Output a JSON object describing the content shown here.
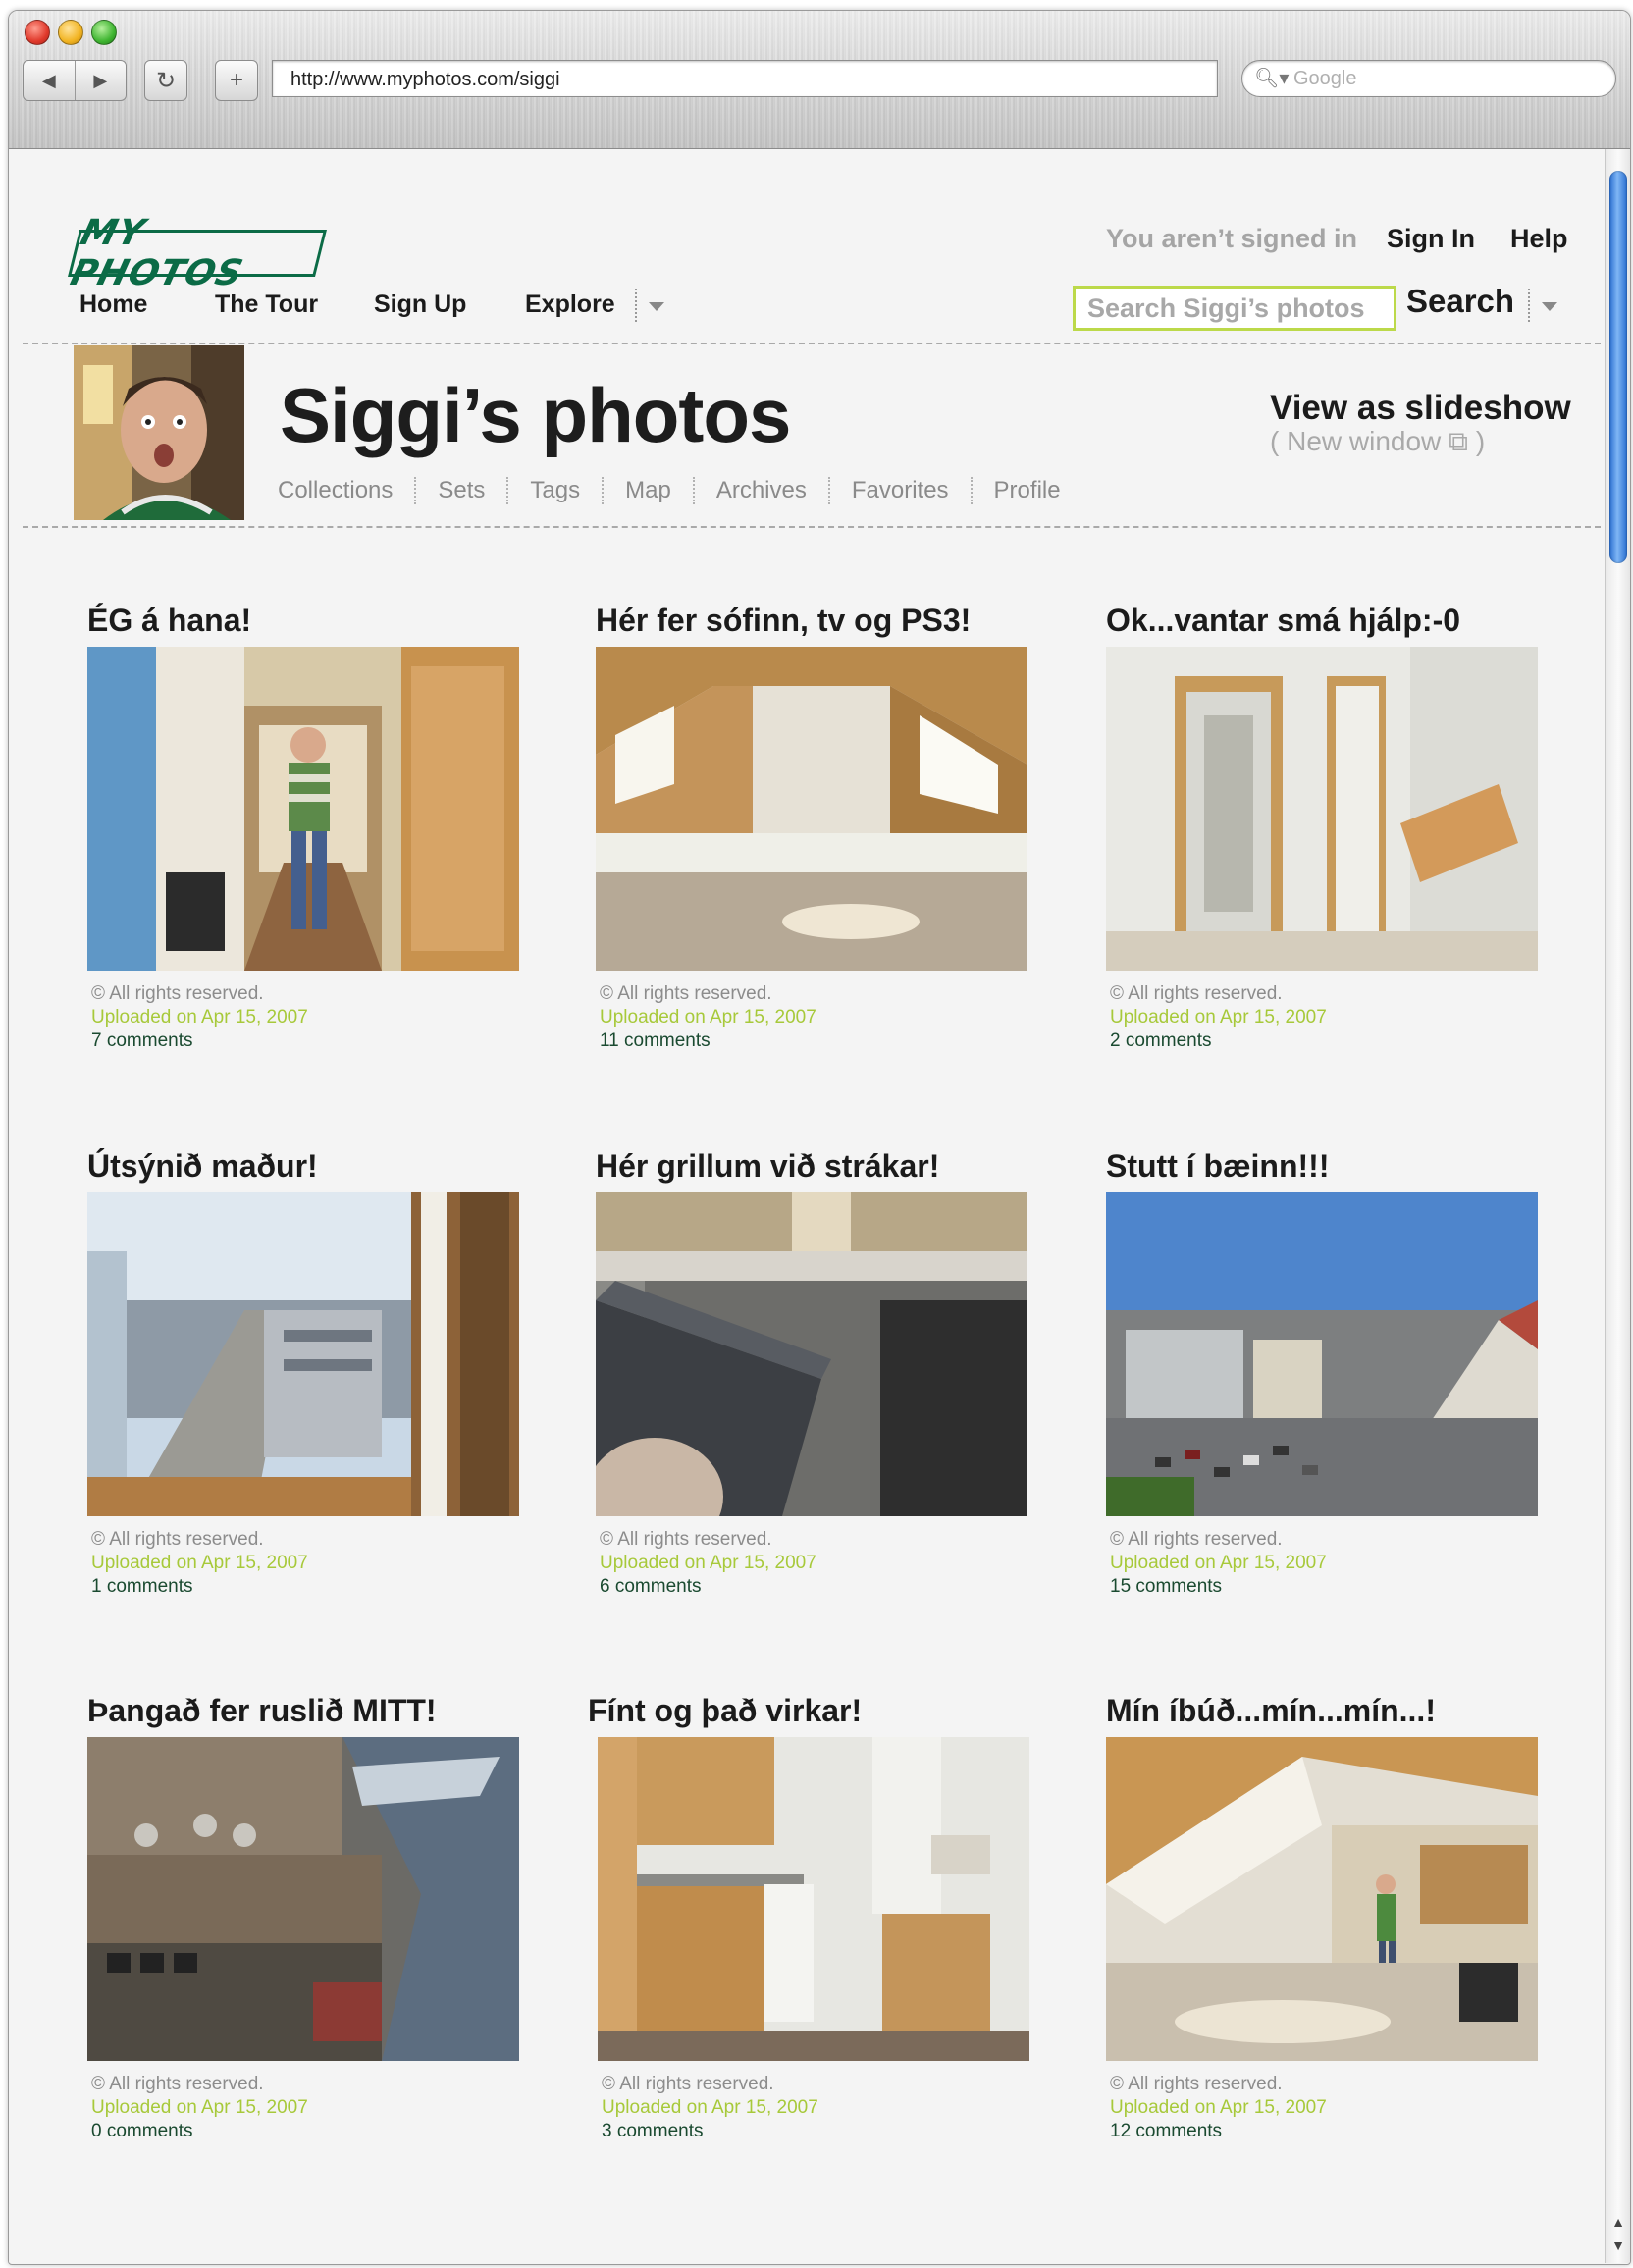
{
  "browser": {
    "url": "http://www.myphotos.com/siggi",
    "search_placeholder": "Google",
    "search_icon": "magnifier-icon",
    "back_icon": "back-arrow-icon",
    "forward_icon": "forward-arrow-icon",
    "reload_icon": "reload-icon",
    "add_icon": "plus-icon"
  },
  "site": {
    "logo": "MY PHOTOS",
    "nav": [
      "Home",
      "The Tour",
      "Sign Up",
      "Explore"
    ],
    "signed_in_text": "You aren’t signed in",
    "sign_in": "Sign In",
    "help": "Help",
    "search_placeholder": "Search Siggi’s photos",
    "search_label": "Search"
  },
  "profile": {
    "title": "Siggi’s photos",
    "tabs": [
      "Collections",
      "Sets",
      "Tags",
      "Map",
      "Archives",
      "Favorites",
      "Profile"
    ],
    "slideshow": "View as slideshow",
    "new_window": "( New window ⧉ )"
  },
  "photos": [
    {
      "title": "ÉG á hana!",
      "rights": "© All rights reserved.",
      "uploaded": "Uploaded on Apr 15, 2007",
      "comments": "7 comments"
    },
    {
      "title": "Hér fer sófinn, tv og PS3!",
      "rights": "© All rights reserved.",
      "uploaded": "Uploaded on Apr 15, 2007",
      "comments": "11 comments"
    },
    {
      "title": "Ok...vantar smá hjálp:-0",
      "rights": "© All rights reserved.",
      "uploaded": "Uploaded on Apr 15, 2007",
      "comments": "2 comments"
    },
    {
      "title": "Útsýnið maður!",
      "rights": "© All rights reserved.",
      "uploaded": "Uploaded on Apr 15, 2007",
      "comments": "1 comments"
    },
    {
      "title": "Hér grillum við strákar!",
      "rights": "© All rights reserved.",
      "uploaded": "Uploaded on Apr 15, 2007",
      "comments": "6 comments"
    },
    {
      "title": "Stutt í bæinn!!!",
      "rights": "© All rights reserved.",
      "uploaded": "Uploaded on Apr 15, 2007",
      "comments": "15 comments"
    },
    {
      "title": "Þangað fer ruslið MITT!",
      "rights": "© All rights reserved.",
      "uploaded": "Uploaded on Apr 15, 2007",
      "comments": "0 comments"
    },
    {
      "title": "Fínt og það virkar!",
      "rights": "© All rights reserved.",
      "uploaded": "Uploaded on Apr 15, 2007",
      "comments": "3 comments"
    },
    {
      "title": "Mín íbúð...mín...mín...!",
      "rights": "© All rights reserved.",
      "uploaded": "Uploaded on Apr 15, 2007",
      "comments": "12 comments"
    }
  ],
  "colors": {
    "brand": "#0b6b46",
    "accent": "#bcd94a",
    "uploaded": "#a7c93a"
  }
}
